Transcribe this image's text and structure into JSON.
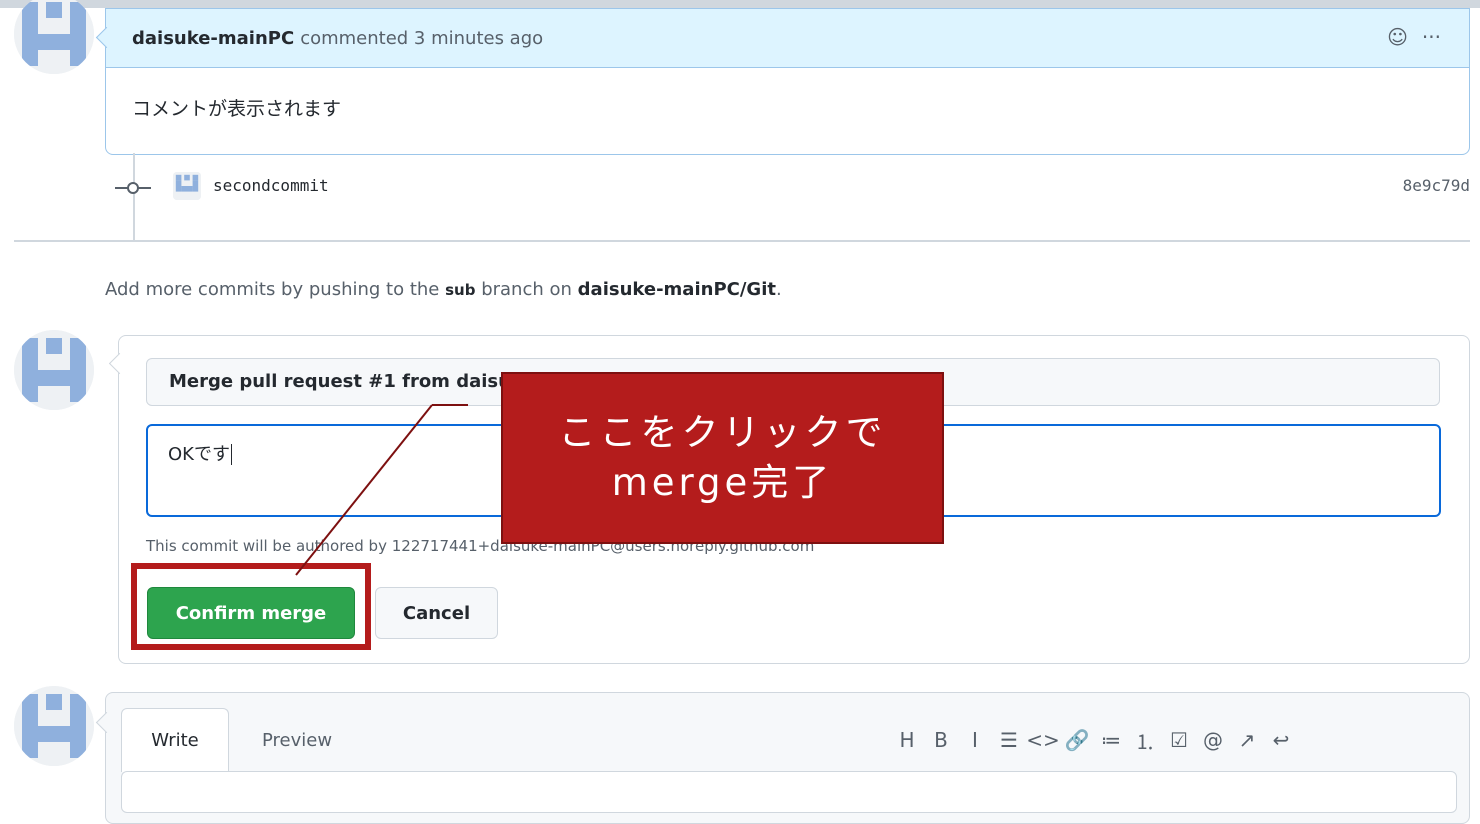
{
  "comment": {
    "author": "daisuke-mainPC",
    "action": "commented 3 minutes ago",
    "body": "コメントが表示されます"
  },
  "commit": {
    "message": "secondcommit",
    "sha": "8e9c79d"
  },
  "push_info": {
    "prefix": "Add more commits by pushing to the",
    "branch": "sub",
    "middle": "branch on",
    "repo": "daisuke-mainPC/Git",
    "suffix": "."
  },
  "merge": {
    "title_value": "Merge pull request #1 from daisu",
    "message_value": "OKです",
    "author_note": "This commit will be authored by 122717441+daisuke-mainPC@users.noreply.github.com",
    "confirm_label": "Confirm merge",
    "cancel_label": "Cancel"
  },
  "callout": {
    "line1": "ここをクリックで",
    "line2": "merge完了"
  },
  "composer": {
    "tab_write": "Write",
    "tab_preview": "Preview",
    "toolbar": [
      {
        "name": "heading-icon",
        "glyph": "H"
      },
      {
        "name": "bold-icon",
        "glyph": "B"
      },
      {
        "name": "italic-icon",
        "glyph": "I"
      },
      {
        "name": "quote-icon",
        "glyph": "☰"
      },
      {
        "name": "code-icon",
        "glyph": "<>"
      },
      {
        "name": "link-icon",
        "glyph": "🔗"
      },
      {
        "name": "bulleted-list-icon",
        "glyph": "≔"
      },
      {
        "name": "numbered-list-icon",
        "glyph": "⒈"
      },
      {
        "name": "task-list-icon",
        "glyph": "☑"
      },
      {
        "name": "mention-icon",
        "glyph": "@"
      },
      {
        "name": "cross-reference-icon",
        "glyph": "↗"
      },
      {
        "name": "saved-reply-icon",
        "glyph": "↩"
      }
    ]
  },
  "colors": {
    "accent_blue": "#0969da",
    "merge_green": "#2da44e",
    "callout_red": "#b41c1c"
  }
}
